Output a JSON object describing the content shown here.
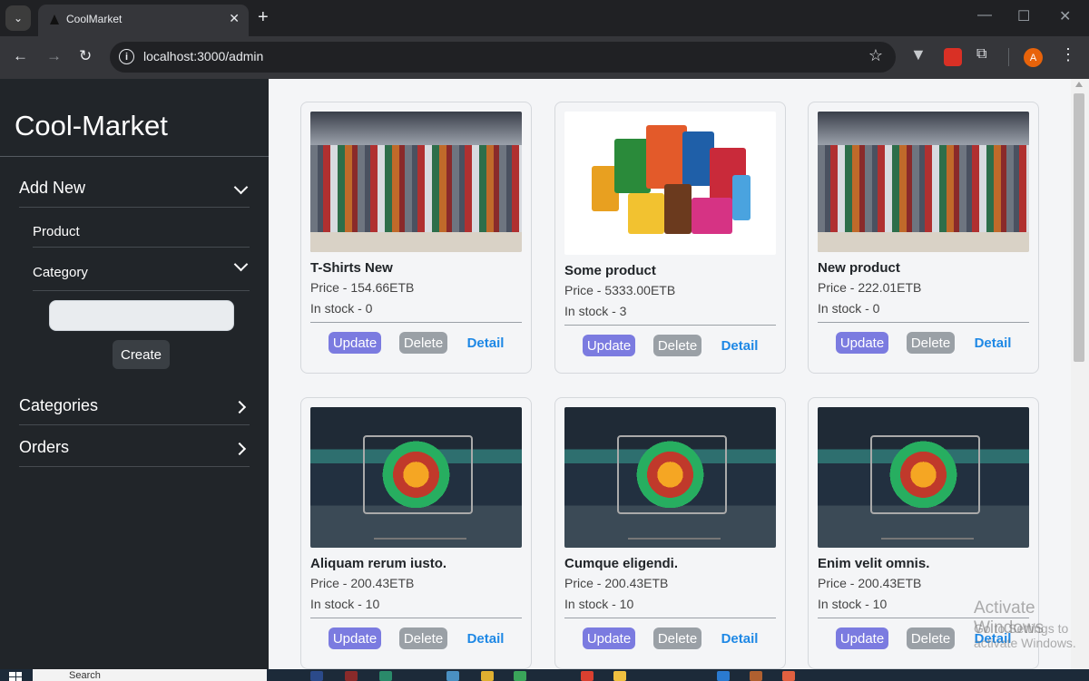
{
  "browser": {
    "tab_title": "CoolMarket",
    "tab_close": "✕",
    "new_tab": "+",
    "url": "localhost:3000/admin",
    "profile_initial": "A",
    "window_controls": [
      "—",
      "☐",
      "✕"
    ]
  },
  "sidebar": {
    "brand": "Cool-Market",
    "add_new_label": "Add New",
    "product_label": "Product",
    "category_label": "Category",
    "category_input_placeholder": "",
    "create_label": "Create",
    "categories_label": "Categories",
    "orders_label": "Orders"
  },
  "buttons": {
    "update": "Update",
    "delete": "Delete",
    "detail": "Detail"
  },
  "products": [
    {
      "name": "T-Shirts New",
      "price": "Price - 154.66ETB",
      "stock": "In stock - 0",
      "image": "clothes-rack"
    },
    {
      "name": "Some product",
      "price": "Price - 5333.00ETB",
      "stock": "In stock - 3",
      "image": "grocery-packages"
    },
    {
      "name": "New product",
      "price": "Price - 222.01ETB",
      "stock": "In stock - 0",
      "image": "clothes-rack"
    },
    {
      "name": "Aliquam rerum iusto.",
      "price": "Price - 200.43ETB",
      "stock": "In stock - 10",
      "image": "shopping-cart"
    },
    {
      "name": "Cumque eligendi.",
      "price": "Price - 200.43ETB",
      "stock": "In stock - 10",
      "image": "shopping-cart"
    },
    {
      "name": "Enim velit omnis.",
      "price": "Price - 200.43ETB",
      "stock": "In stock - 10",
      "image": "shopping-cart"
    }
  ],
  "watermark": {
    "title": "Activate Windows",
    "subtitle": "Go to Settings to activate Windows."
  },
  "taskbar": {
    "search_text": "Search"
  },
  "colors": {
    "sidebar_bg": "#212529",
    "update_button": "#7b7be0",
    "delete_button": "#9aa0a6",
    "detail_link": "#1e88e5"
  }
}
